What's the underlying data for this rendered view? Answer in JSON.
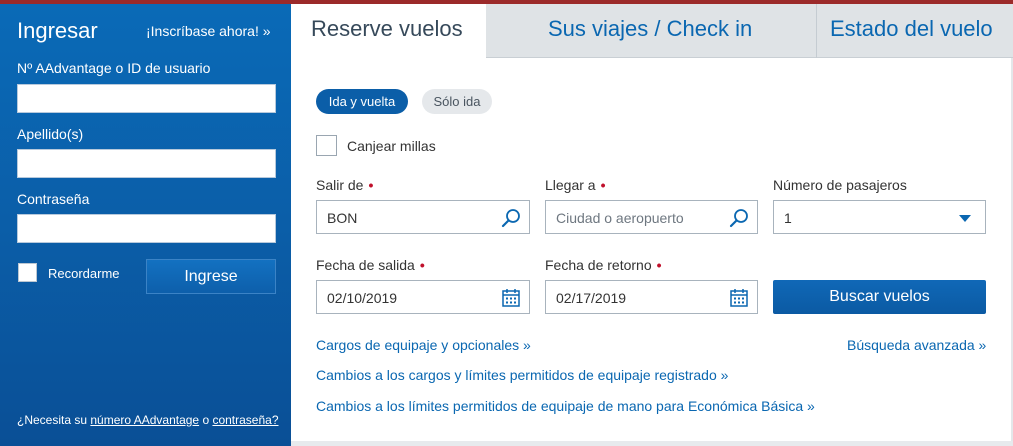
{
  "colors": {
    "brand_blue": "#0b5ea8",
    "link_blue": "#0a67b1",
    "required_red": "#c0102b",
    "tab_inactive": "#dfe3e6"
  },
  "login": {
    "title": "Ingresar",
    "signup_link": "¡Inscríbase ahora! »",
    "username_label": "Nº AAdvantage o ID de usuario",
    "username_value": "",
    "lastname_label": "Apellido(s)",
    "lastname_value": "",
    "password_label": "Contraseña",
    "password_value": "",
    "remember_label": "Recordarme",
    "submit_label": "Ingrese",
    "help_prefix": "¿Necesita su ",
    "help_link_number": "número AAdvantage",
    "help_or": " o ",
    "help_link_password": "contraseña?"
  },
  "tabs": [
    {
      "label": "Reserve vuelos",
      "active": true
    },
    {
      "label": "Sus viajes / Check in",
      "active": false
    },
    {
      "label": "Estado del vuelo",
      "active": false
    }
  ],
  "booking": {
    "trip_types": {
      "round_trip": "Ida y vuelta",
      "one_way": "Sólo ida",
      "selected": "Ida y vuelta"
    },
    "redeem_miles_label": "Canjear millas",
    "from": {
      "label": "Salir de",
      "value": "BON",
      "icon": "search-icon"
    },
    "to": {
      "label": "Llegar a",
      "placeholder": "Ciudad o aeropuerto",
      "value": "",
      "icon": "search-icon"
    },
    "passengers": {
      "label": "Número de pasajeros",
      "value": "1",
      "icon": "chevron-down-icon"
    },
    "depart_date": {
      "label": "Fecha de salida",
      "value": "02/10/2019",
      "icon": "calendar-icon"
    },
    "return_date": {
      "label": "Fecha de retorno",
      "value": "02/17/2019",
      "icon": "calendar-icon"
    },
    "search_button": "Buscar vuelos",
    "links": {
      "baggage_fees": "Cargos de equipaje y opcionales »",
      "advanced_search": "Búsqueda avanzada »",
      "checked_baggage_changes": "Cambios a los cargos y límites permitidos de equipaje registrado »",
      "carryon_changes": "Cambios a los límites permitidos de equipaje de mano para Económica Básica »"
    }
  }
}
